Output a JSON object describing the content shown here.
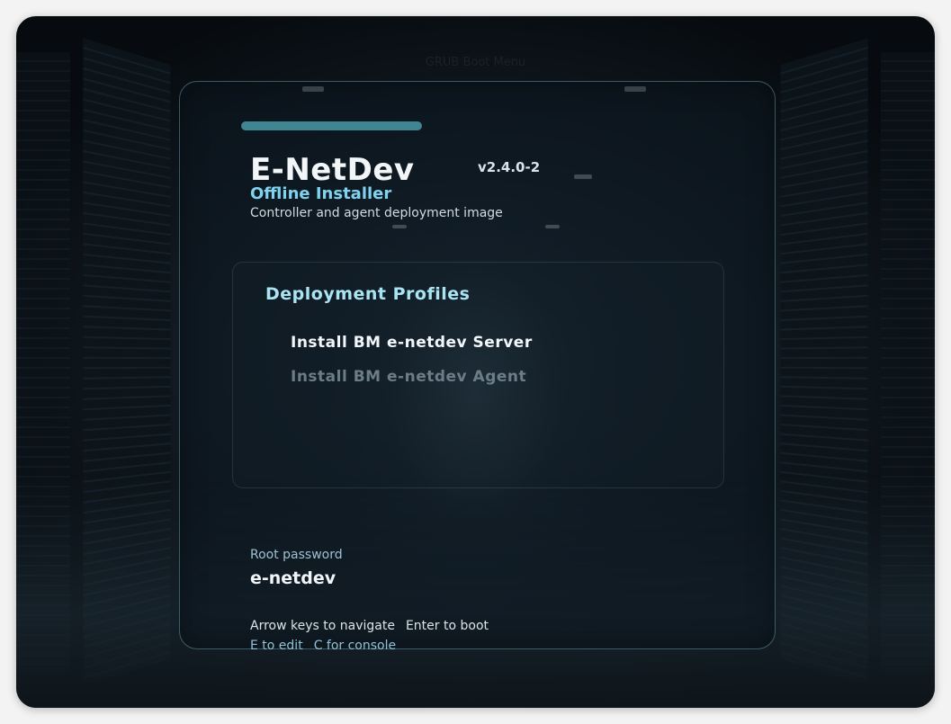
{
  "window": {
    "menu_title": "GRUB Boot Menu"
  },
  "header": {
    "app_title": "E-NetDev",
    "version": "v2.4.0-2",
    "subtitle": "Offline Installer",
    "tagline": "Controller and agent deployment image"
  },
  "profiles": {
    "heading": "Deployment Profiles",
    "items": [
      {
        "label": "Install BM e-netdev Server",
        "selected": true
      },
      {
        "label": "Install BM e-netdev Agent",
        "selected": false
      }
    ]
  },
  "credentials": {
    "label": "Root password",
    "value": "e-netdev"
  },
  "hints": {
    "navigate": "Arrow keys to navigate",
    "boot": "Enter to boot",
    "edit": "E to edit",
    "console": "C for console"
  },
  "colors": {
    "accent": "#3f8592",
    "subtitle": "#7fd3ef",
    "heading": "#a9e4f3",
    "selected_item": "#f4f7f9",
    "unselected_item": "#6c7d88"
  }
}
